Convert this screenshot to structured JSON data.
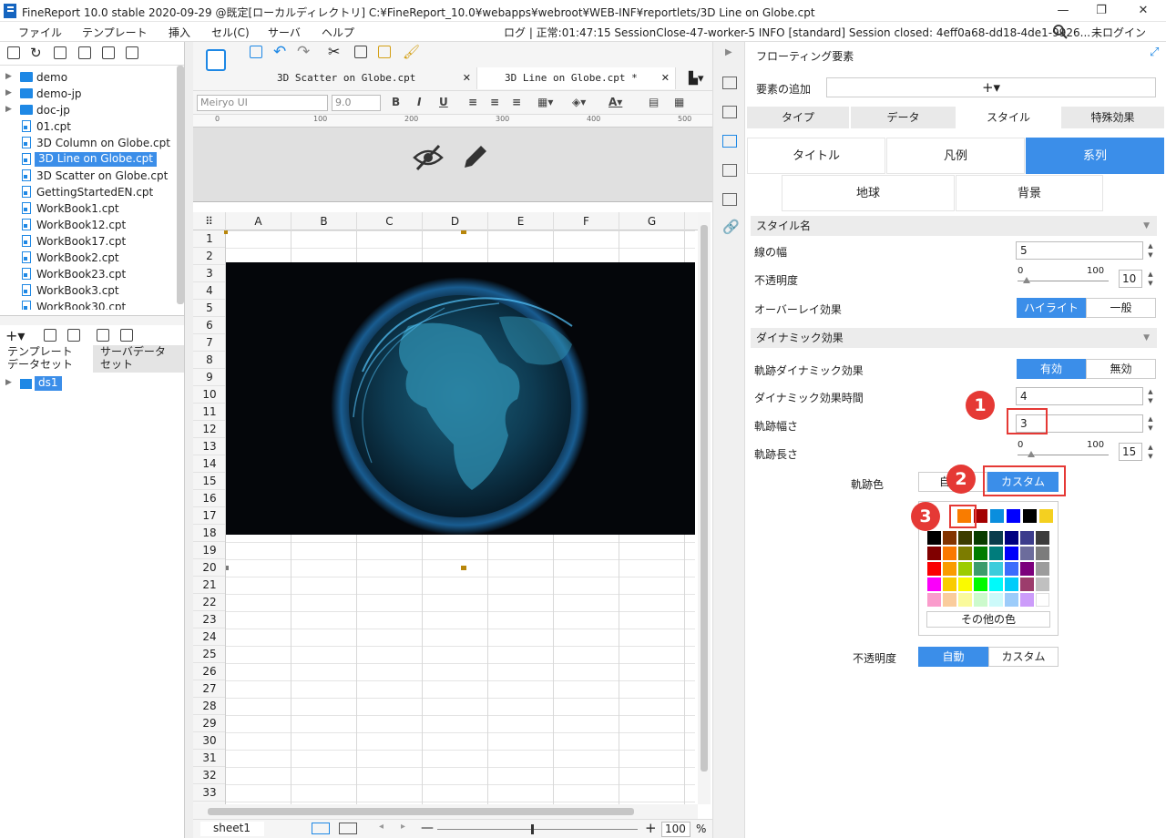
{
  "window": {
    "title": "FineReport 10.0 stable 2020-09-29 @既定[ローカルディレクトリ]   C:¥FineReport_10.0¥webapps¥webroot¥WEB-INF¥reportlets/3D Line on Globe.cpt"
  },
  "menu": [
    "ファイル",
    "テンプレート",
    "挿入",
    "セル(C)",
    "サーバ",
    "ヘルプ"
  ],
  "log_line": "ログ | 正常:01:47:15 SessionClose-47-worker-5 INFO [standard] Session closed: 4eff0a68-dd18-4de1-9926...",
  "login": "未ログイン",
  "tree": [
    {
      "label": "demo",
      "type": "folder"
    },
    {
      "label": "demo-jp",
      "type": "folder"
    },
    {
      "label": "doc-jp",
      "type": "folder"
    },
    {
      "label": "01.cpt",
      "type": "file"
    },
    {
      "label": "3D Column on Globe.cpt",
      "type": "file"
    },
    {
      "label": "3D Line on Globe.cpt",
      "type": "file",
      "selected": true
    },
    {
      "label": "3D Scatter on Globe.cpt",
      "type": "file"
    },
    {
      "label": "GettingStartedEN.cpt",
      "type": "file"
    },
    {
      "label": "WorkBook1.cpt",
      "type": "file"
    },
    {
      "label": "WorkBook12.cpt",
      "type": "file"
    },
    {
      "label": "WorkBook17.cpt",
      "type": "file"
    },
    {
      "label": "WorkBook2.cpt",
      "type": "file"
    },
    {
      "label": "WorkBook23.cpt",
      "type": "file"
    },
    {
      "label": "WorkBook3.cpt",
      "type": "file"
    },
    {
      "label": "WorkBook30.cpt",
      "type": "file"
    }
  ],
  "dataset_tabs": {
    "template": "テンプレート\nデータセット",
    "server": "サーバデータ\nセット"
  },
  "dataset_item": "ds1",
  "editor_tabs": [
    {
      "label": "3D Scatter on Globe.cpt",
      "active": false
    },
    {
      "label": "3D Line on Globe.cpt *",
      "active": true
    }
  ],
  "format": {
    "font": "Meiryo UI",
    "size": "9.0"
  },
  "ruler": [
    "0",
    "100",
    "200",
    "300",
    "400",
    "500"
  ],
  "columns": [
    "A",
    "B",
    "C",
    "D",
    "E",
    "F",
    "G"
  ],
  "rows": [
    "1",
    "2",
    "3",
    "4",
    "5",
    "6",
    "7",
    "8",
    "9",
    "10",
    "11",
    "12",
    "13",
    "14",
    "15",
    "16",
    "17",
    "18",
    "19",
    "20",
    "21",
    "22",
    "23",
    "24",
    "25",
    "26",
    "27",
    "28",
    "29",
    "30",
    "31",
    "32",
    "33"
  ],
  "status": {
    "sheet": "sheet1",
    "zoom": "100",
    "pct": "%"
  },
  "rpanel": {
    "header": "フローティング要素",
    "add_label": "要素の追加",
    "add_symbol": "+▾",
    "tabs": [
      "タイプ",
      "データ",
      "スタイル",
      "特殊効果"
    ],
    "subtabs_row1": [
      "タイトル",
      "凡例",
      "系列"
    ],
    "subtabs_row2": [
      "地球",
      "背景"
    ],
    "sections": {
      "style_name": "スタイル名",
      "dynamic": "ダイナミック効果"
    },
    "line_width": {
      "label": "線の幅",
      "value": "5"
    },
    "opacity": {
      "label": "不透明度",
      "min": "0",
      "max": "100",
      "value": "10",
      "level": 0.1
    },
    "overlay": {
      "label": "オーバーレイ効果",
      "options": [
        "ハイライト",
        "一般"
      ]
    },
    "trail_dyn": {
      "label": "軌跡ダイナミック効果",
      "options": [
        "有効",
        "無効"
      ]
    },
    "dyn_time": {
      "label": "ダイナミック効果時間",
      "value": "4"
    },
    "trail_width": {
      "label": "軌跡幅さ",
      "value": "3"
    },
    "trail_len": {
      "label": "軌跡長さ",
      "min": "0",
      "max": "100",
      "value": "15",
      "level": 0.15
    },
    "trail_color": {
      "label": "軌跡色",
      "options": [
        "自",
        "カスタム"
      ]
    },
    "more_colors": "その他の色",
    "opacity2": {
      "label": "不透明度",
      "options": [
        "自動",
        "カスタム"
      ]
    }
  },
  "badges": [
    "1",
    "2",
    "3"
  ],
  "palette": {
    "top": [
      "#f97c00",
      "#a30000",
      "#0a8ede",
      "#0000ff",
      "#000000",
      "#f4d020"
    ],
    "grid": [
      [
        "#000000",
        "#833400",
        "#3c3c00",
        "#083c00",
        "#0a3c4c",
        "#000080",
        "#3c3c8c",
        "#3c3c3c"
      ],
      [
        "#800000",
        "#fa7800",
        "#7c7c00",
        "#007c00",
        "#007c7c",
        "#0000fa",
        "#6c6c9c",
        "#7c7c7c"
      ],
      [
        "#fa0000",
        "#fa9c00",
        "#9ccc00",
        "#3c9c6c",
        "#3cccdc",
        "#3c6cfc",
        "#7c007c",
        "#9c9c9c"
      ],
      [
        "#fa00fa",
        "#facc00",
        "#fafa00",
        "#00fa00",
        "#00fafa",
        "#00ccfa",
        "#9c3c6c",
        "#c0c0c0"
      ],
      [
        "#fa9ccc",
        "#facc9c",
        "#fafa9c",
        "#ccfacc",
        "#ccfafa",
        "#9cccfa",
        "#cc9cfa",
        "#ffffff"
      ]
    ]
  },
  "colors": {
    "accent": "#3b8ee9",
    "highlight": "#e53935"
  }
}
